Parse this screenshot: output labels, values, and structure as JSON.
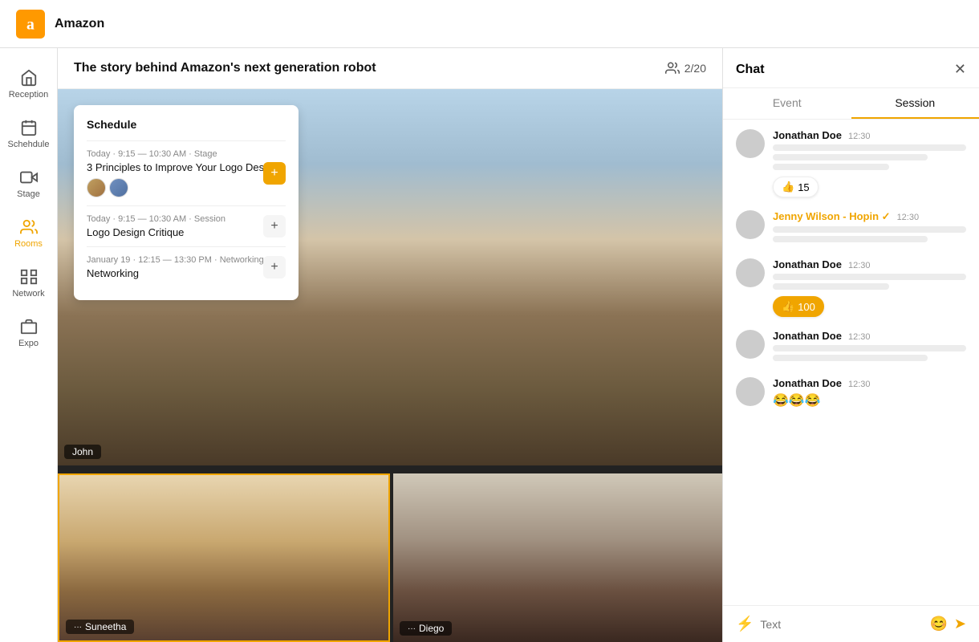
{
  "app": {
    "logo_text": "a",
    "title": "Amazon"
  },
  "sidebar": {
    "items": [
      {
        "id": "reception",
        "label": "Reception",
        "icon": "home"
      },
      {
        "id": "schedule",
        "label": "Schehdule",
        "icon": "calendar"
      },
      {
        "id": "stage",
        "label": "Stage",
        "icon": "video"
      },
      {
        "id": "rooms",
        "label": "Rooms",
        "icon": "people",
        "active": true
      },
      {
        "id": "network",
        "label": "Network",
        "icon": "grid"
      },
      {
        "id": "expo",
        "label": "Expo",
        "icon": "building"
      }
    ]
  },
  "event": {
    "title": "The story behind Amazon's next generation robot",
    "attendee_count": "2/20",
    "attendee_icon": "people"
  },
  "schedule": {
    "title": "Schedule",
    "items": [
      {
        "meta": "Today · 9:15 — 10:30 AM · Stage",
        "name": "3 Principles to Improve Your Logo Design",
        "has_avatars": true,
        "btn_type": "orange"
      },
      {
        "meta": "Today · 9:15 — 10:30 AM · Session",
        "name": "Logo Design Critique",
        "has_avatars": false,
        "btn_type": "gray"
      },
      {
        "meta": "January 19 · 12:15 — 13:30 PM · Networking",
        "name": "Networking",
        "has_avatars": false,
        "btn_type": "gray"
      }
    ]
  },
  "video": {
    "participants": [
      {
        "name": "John",
        "position": "main"
      },
      {
        "name": "Suneetha",
        "position": "bottom-left",
        "highlighted": true
      },
      {
        "name": "Diego",
        "position": "bottom-right"
      }
    ]
  },
  "chat": {
    "title": "Chat",
    "tabs": [
      {
        "id": "event",
        "label": "Event",
        "active": false
      },
      {
        "id": "session",
        "label": "Session",
        "active": true
      }
    ],
    "messages": [
      {
        "name": "Jonathan Doe",
        "name_class": "",
        "time": "12:30",
        "lines": [
          "long",
          "medium",
          "short"
        ],
        "reaction": null,
        "emoji": null
      },
      {
        "name": "Jenny Wilson - Hopin ✓",
        "name_class": "hopin",
        "time": "12:30",
        "lines": [
          "long",
          "medium"
        ],
        "reaction": null,
        "emoji": null
      },
      {
        "name": "Jonathan Doe",
        "name_class": "",
        "time": "12:30",
        "lines": [
          "long",
          "short"
        ],
        "reaction": {
          "count": "100",
          "type": "orange"
        },
        "emoji": null
      },
      {
        "name": "Jonathan Doe",
        "name_class": "",
        "time": "12:30",
        "lines": [
          "long",
          "medium"
        ],
        "reaction": null,
        "emoji": null
      },
      {
        "name": "Jonathan Doe",
        "name_class": "",
        "time": "12:30",
        "lines": [],
        "reaction": null,
        "emoji": "😂😂😂"
      }
    ],
    "reaction_15": "15",
    "input": {
      "placeholder": "Text",
      "lightning_icon": "⚡",
      "emoji_icon": "😊",
      "send_icon": "➤"
    }
  }
}
